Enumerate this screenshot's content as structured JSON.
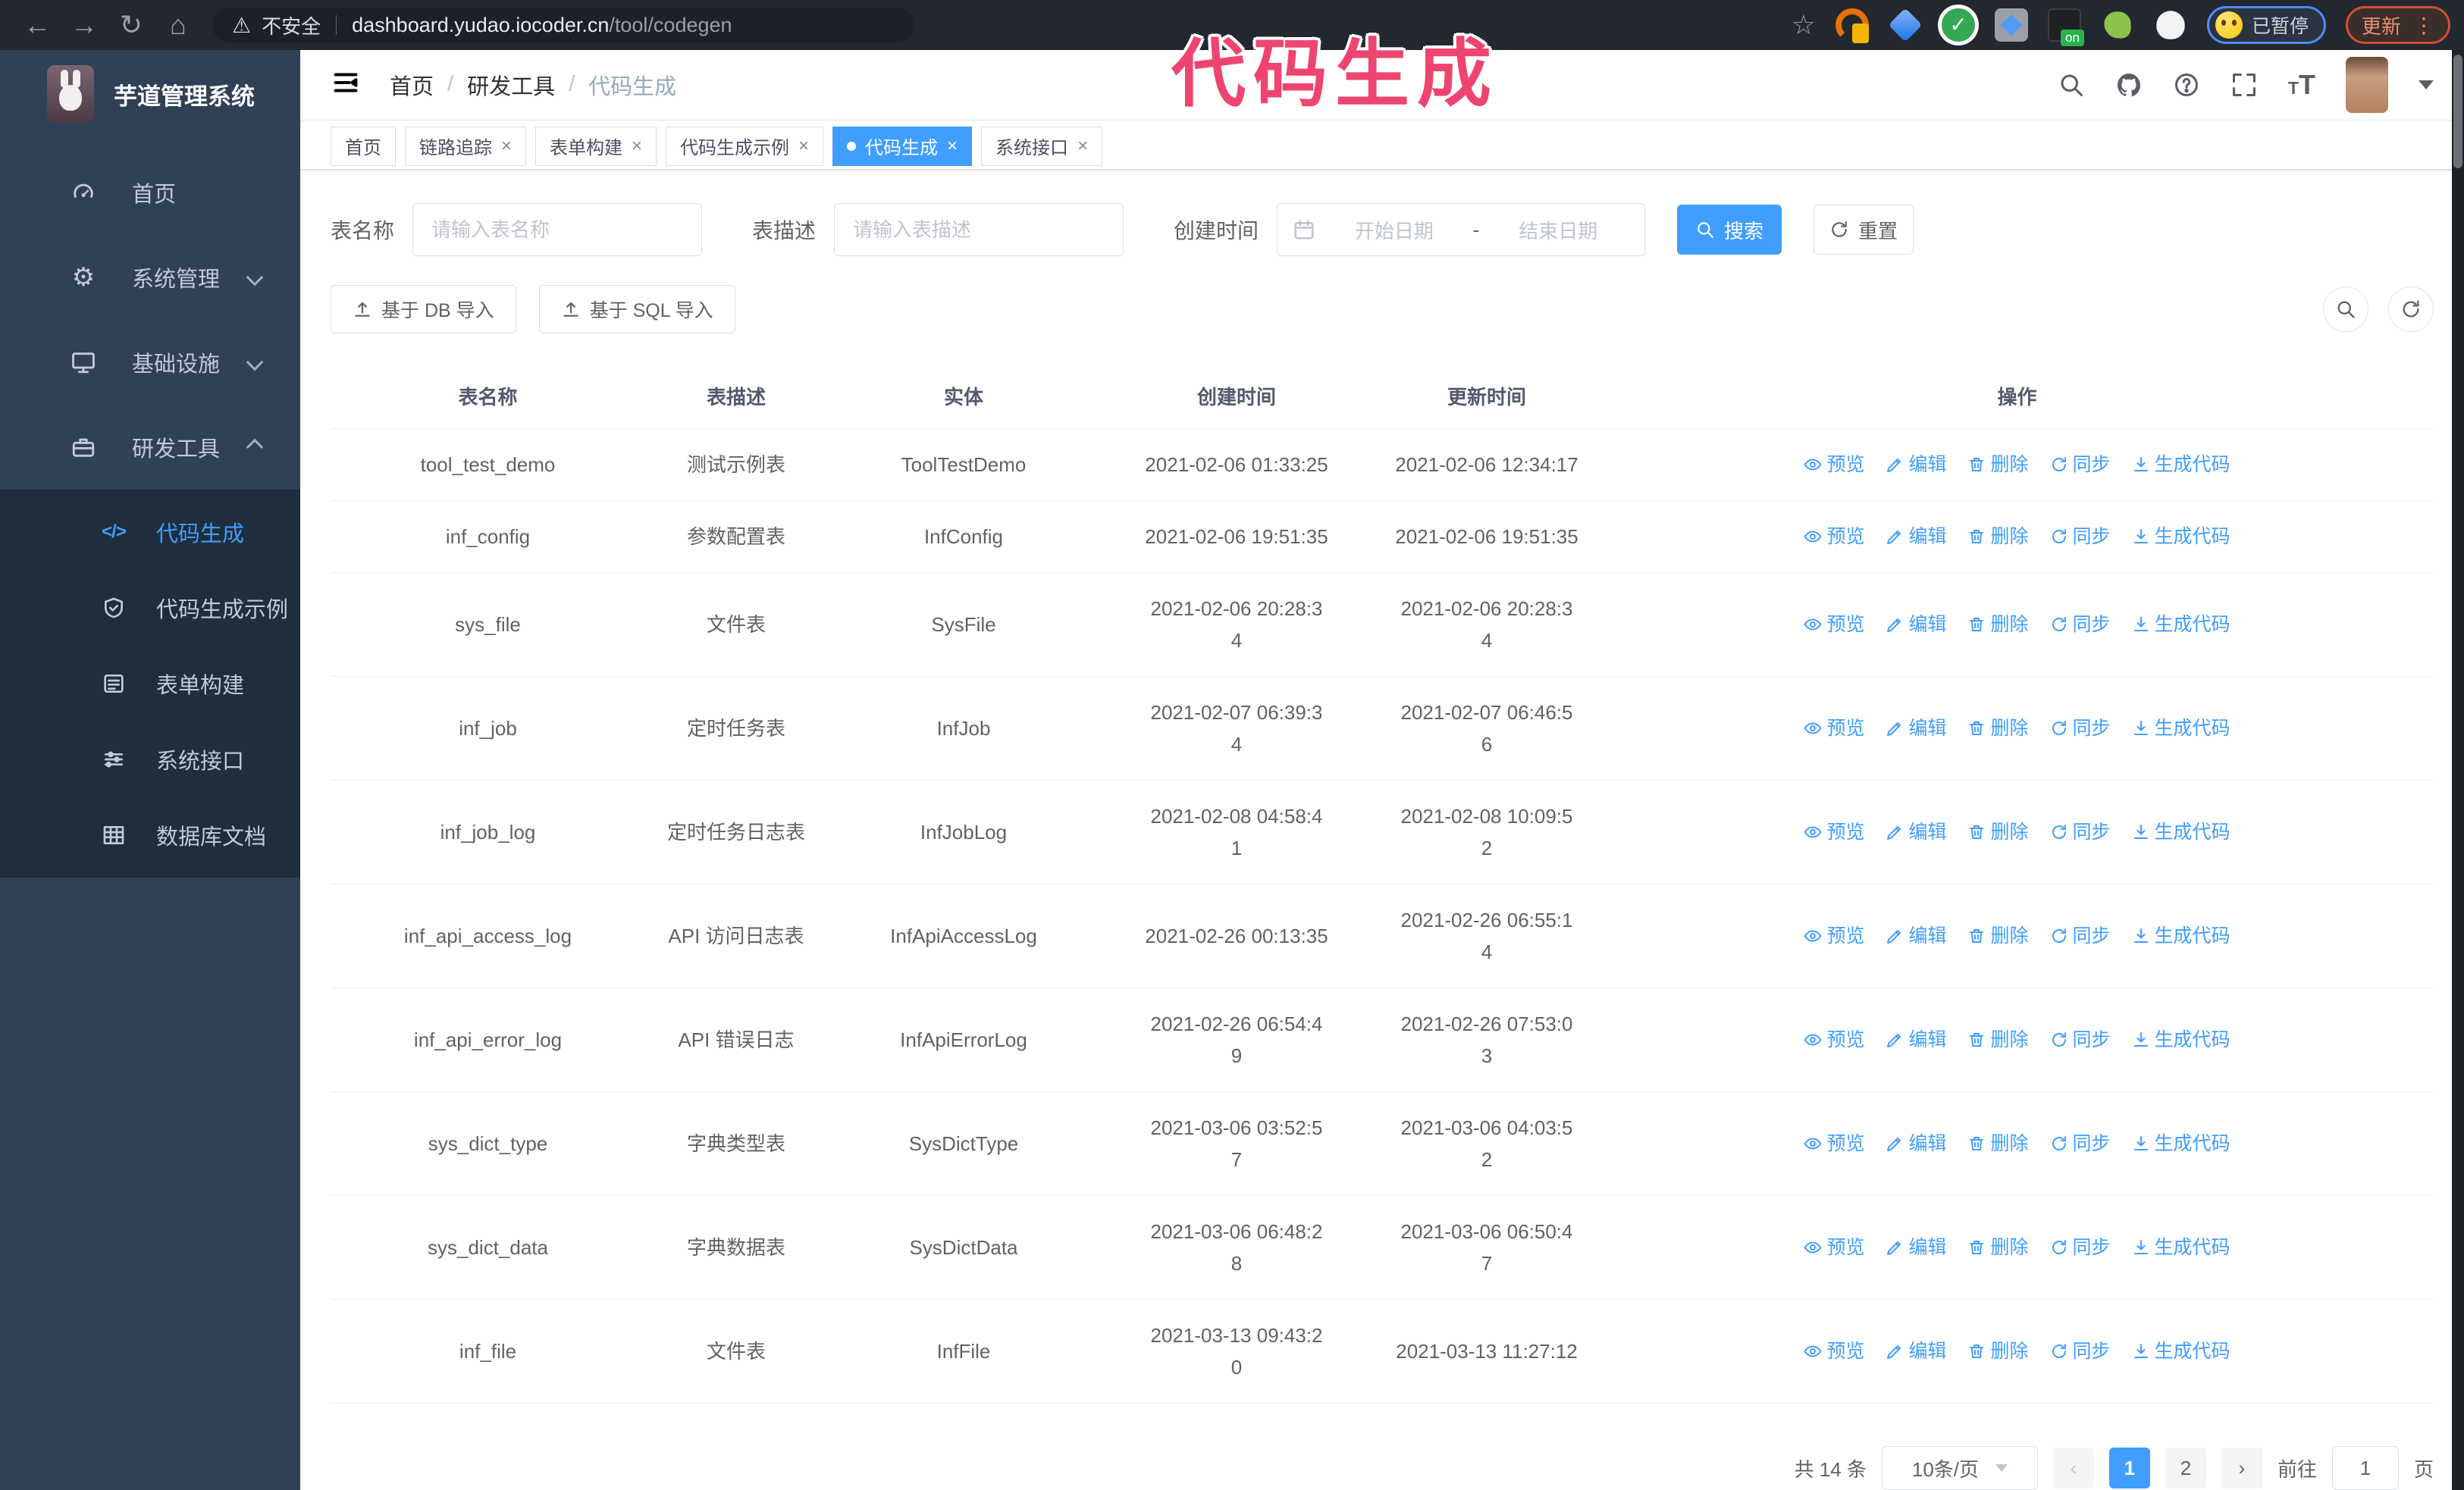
{
  "browser": {
    "security_label": "不安全",
    "url_host": "dashboard.yudao.iocoder.cn",
    "url_path": "/tool/codegen",
    "profile_chip": "已暂停",
    "update_button": "更新",
    "menu_dots": "⋮"
  },
  "annotation": {
    "text": "代码生成",
    "color": "#ee4570"
  },
  "sidebar": {
    "title": "芋道管理系统",
    "items": [
      {
        "label": "首页"
      },
      {
        "label": "系统管理"
      },
      {
        "label": "基础设施"
      },
      {
        "label": "研发工具"
      }
    ],
    "submenu": [
      {
        "label": "代码生成"
      },
      {
        "label": "代码生成示例"
      },
      {
        "label": "表单构建"
      },
      {
        "label": "系统接口"
      },
      {
        "label": "数据库文档"
      }
    ]
  },
  "navbar": {
    "breadcrumb": [
      "首页",
      "研发工具",
      "代码生成"
    ]
  },
  "tabs": [
    {
      "label": "首页"
    },
    {
      "label": "链路追踪"
    },
    {
      "label": "表单构建"
    },
    {
      "label": "代码生成示例"
    },
    {
      "label": "代码生成"
    },
    {
      "label": "系统接口"
    }
  ],
  "filters": {
    "table_name_label": "表名称",
    "table_name_placeholder": "请输入表名称",
    "table_desc_label": "表描述",
    "table_desc_placeholder": "请输入表描述",
    "create_time_label": "创建时间",
    "date_start_placeholder": "开始日期",
    "date_separator": "-",
    "date_end_placeholder": "结束日期",
    "search_label": "搜索",
    "reset_label": "重置"
  },
  "toolbar": {
    "import_db_label": "基于 DB 导入",
    "import_sql_label": "基于 SQL 导入"
  },
  "table": {
    "columns": [
      "表名称",
      "表描述",
      "实体",
      "创建时间",
      "更新时间",
      "操作"
    ],
    "row_actions": [
      "预览",
      "编辑",
      "删除",
      "同步",
      "生成代码"
    ],
    "rows": [
      {
        "name": "tool_test_demo",
        "desc": "测试示例表",
        "entity": "ToolTestDemo",
        "created": "2021-02-06 01:33:25",
        "updated": "2021-02-06 12:34:17"
      },
      {
        "name": "inf_config",
        "desc": "参数配置表",
        "entity": "InfConfig",
        "created": "2021-02-06 19:51:35",
        "updated": "2021-02-06 19:51:35"
      },
      {
        "name": "sys_file",
        "desc": "文件表",
        "entity": "SysFile",
        "created": "2021-02-06 20:28:3\n4",
        "updated": "2021-02-06 20:28:3\n4"
      },
      {
        "name": "inf_job",
        "desc": "定时任务表",
        "entity": "InfJob",
        "created": "2021-02-07 06:39:3\n4",
        "updated": "2021-02-07 06:46:5\n6"
      },
      {
        "name": "inf_job_log",
        "desc": "定时任务日志表",
        "entity": "InfJobLog",
        "created": "2021-02-08 04:58:4\n1",
        "updated": "2021-02-08 10:09:5\n2"
      },
      {
        "name": "inf_api_access_log",
        "desc": "API 访问日志表",
        "entity": "InfApiAccessLog",
        "created": "2021-02-26 00:13:35",
        "updated": "2021-02-26 06:55:1\n4"
      },
      {
        "name": "inf_api_error_log",
        "desc": "API 错误日志",
        "entity": "InfApiErrorLog",
        "created": "2021-02-26 06:54:4\n9",
        "updated": "2021-02-26 07:53:0\n3"
      },
      {
        "name": "sys_dict_type",
        "desc": "字典类型表",
        "entity": "SysDictType",
        "created": "2021-03-06 03:52:5\n7",
        "updated": "2021-03-06 04:03:5\n2"
      },
      {
        "name": "sys_dict_data",
        "desc": "字典数据表",
        "entity": "SysDictData",
        "created": "2021-03-06 06:48:2\n8",
        "updated": "2021-03-06 06:50:4\n7"
      },
      {
        "name": "inf_file",
        "desc": "文件表",
        "entity": "InfFile",
        "created": "2021-03-13 09:43:2\n0",
        "updated": "2021-03-13 11:27:12"
      }
    ]
  },
  "pagination": {
    "total": "共 14 条",
    "page_size": "10条/页",
    "pages": [
      "1",
      "2"
    ],
    "active_page": "1",
    "goto_label": "前往",
    "goto_value": "1",
    "page_unit": "页"
  },
  "colors": {
    "primary": "#409eff",
    "sidebar_bg": "#304156",
    "submenu_bg": "#1f2d3d",
    "annotation": "#ee4570",
    "chrome_bg": "#23272f"
  }
}
